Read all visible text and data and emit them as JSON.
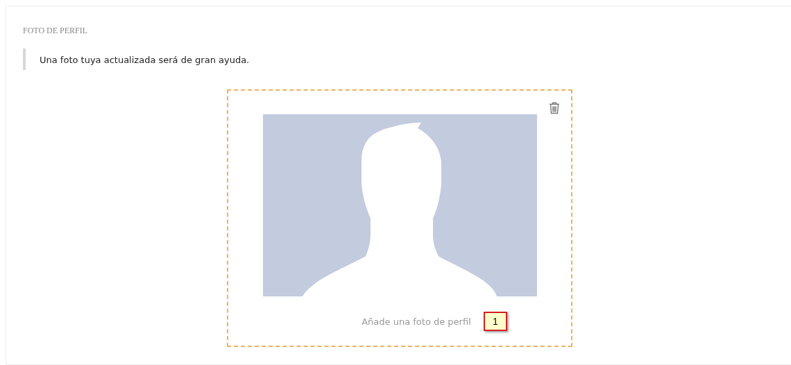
{
  "section": {
    "title": "FOTO DE PERFIL",
    "hint": "Una foto tuya actualizada será de gran ayuda."
  },
  "upload": {
    "caption": "Añade una foto de perfil",
    "callout": "1"
  }
}
